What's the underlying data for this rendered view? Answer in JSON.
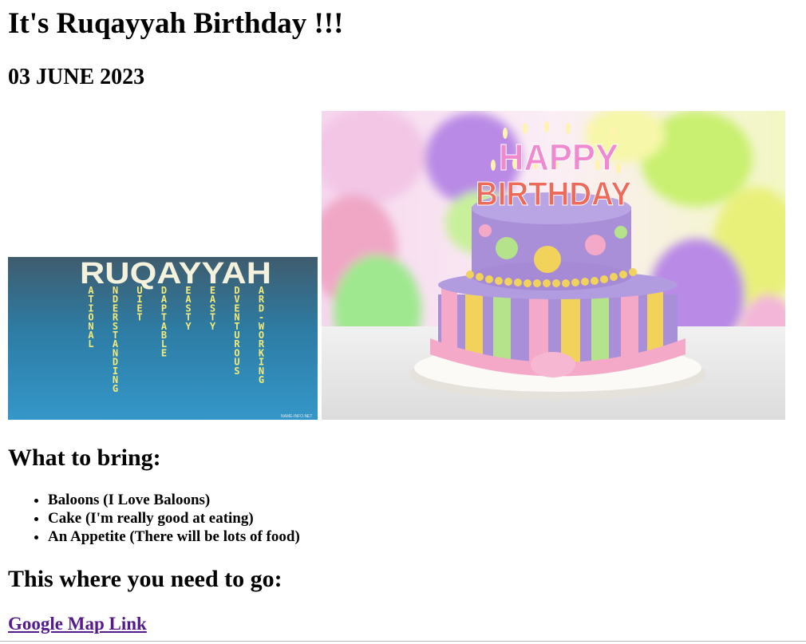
{
  "header": {
    "title": "It's Ruqayyah Birthday !!!",
    "date": "03 JUNE 2023"
  },
  "name_image": {
    "name": "RUQAYYAH",
    "acrostic": [
      {
        "letter": "R",
        "rest": "ATIONAL"
      },
      {
        "letter": "U",
        "rest": "NDERSTANDING"
      },
      {
        "letter": "Q",
        "rest": "UIET"
      },
      {
        "letter": "A",
        "rest": "DAPTABLE"
      },
      {
        "letter": "Y",
        "rest": "EASTY"
      },
      {
        "letter": "Y",
        "rest": "EASTY"
      },
      {
        "letter": "A",
        "rest": "DVENTUROUS"
      },
      {
        "letter": "H",
        "rest": "ARD-WORKING"
      }
    ],
    "watermark": "NAME-INFO.NET"
  },
  "cake_image": {
    "candle_letters_top": "HAPPY",
    "candle_letters_bottom": "BIRTHDAY",
    "colors": {
      "balloon_yellow": "#e9f07a",
      "balloon_purple": "#b98ae6",
      "balloon_green": "#9fe88f",
      "cake_purple": "#a98fd8",
      "ribbon_pink": "#f4a9c9",
      "dot_yellow": "#f1d35c"
    }
  },
  "bring_section": {
    "heading": "What to bring:",
    "items": [
      "Baloons (I Love Baloons)",
      "Cake (I'm really good at eating)",
      "An Appetite (There will be lots of food)"
    ]
  },
  "location_section": {
    "heading": "This where you need to go:",
    "link_text": "Google Map Link"
  },
  "theme": {
    "link_color": "#551a8b"
  }
}
